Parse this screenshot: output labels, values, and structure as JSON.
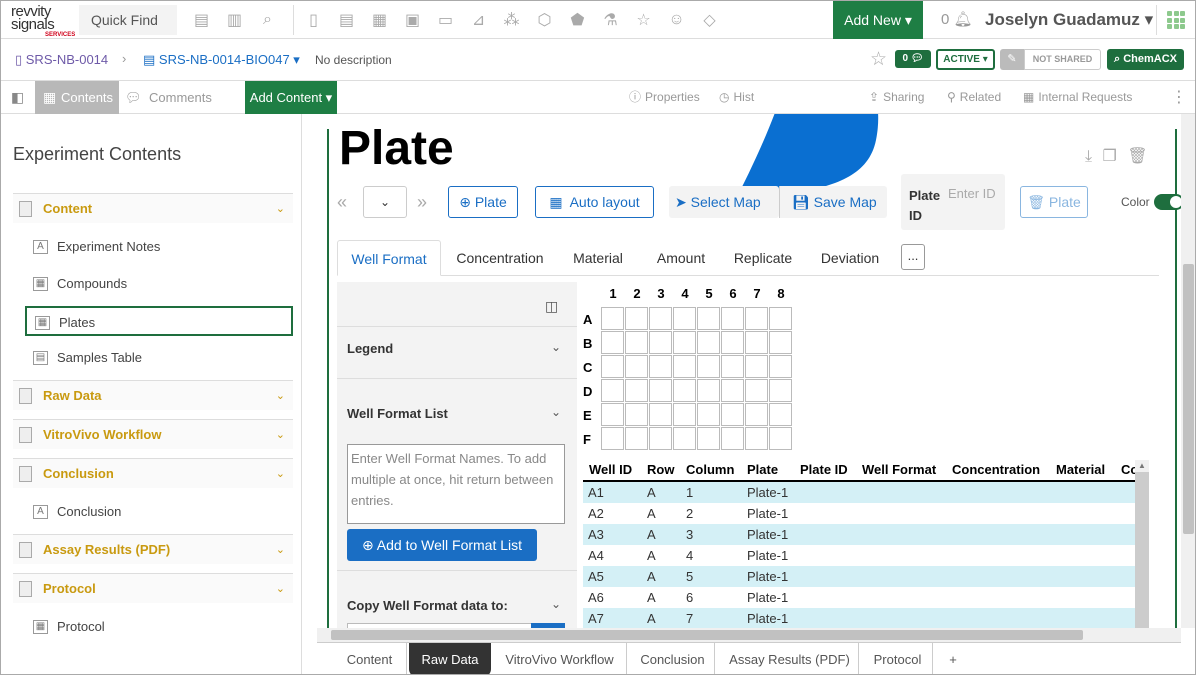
{
  "brand": {
    "line1": "revvity",
    "line2": "signals",
    "line3": "SERVICES"
  },
  "top": {
    "quick_find": "Quick Find",
    "add_new": "Add New ▾",
    "notif_count": "0",
    "user_name": "Joselyn Guadamuz ▾"
  },
  "breadcrumb": {
    "notebook": "SRS-NB-0014",
    "experiment": "SRS-NB-0014-BIO047 ▾",
    "description": "No description",
    "comment_count": "0",
    "status": "ACTIVE ▾",
    "sharing": "NOT SHARED",
    "chem": "ChemACX"
  },
  "toolbar": {
    "contents": "Contents",
    "comments": "Comments",
    "add_content": "Add Content ▾",
    "properties": "Properties",
    "history": "Hist",
    "sharing": "Sharing",
    "related": "Related",
    "internal_requests": "Internal Requests"
  },
  "sidebar": {
    "title": "Experiment Contents",
    "rows": [
      {
        "kind": "cat",
        "label": "Content"
      },
      {
        "kind": "item",
        "label": "Experiment Notes",
        "icon": "A"
      },
      {
        "kind": "item",
        "label": "Compounds",
        "icon": "▦"
      },
      {
        "kind": "item",
        "label": "Plates",
        "icon": "▦",
        "selected": true
      },
      {
        "kind": "item",
        "label": "Samples Table",
        "icon": "▤"
      },
      {
        "kind": "cat",
        "label": "Raw Data"
      },
      {
        "kind": "cat",
        "label": "VitroVivo Workflow"
      },
      {
        "kind": "cat",
        "label": "Conclusion"
      },
      {
        "kind": "item",
        "label": "Conclusion",
        "icon": "A"
      },
      {
        "kind": "cat",
        "label": "Assay Results (PDF)"
      },
      {
        "kind": "cat",
        "label": "Protocol"
      },
      {
        "kind": "item",
        "label": "Protocol",
        "icon": "▦"
      }
    ]
  },
  "plate": {
    "title": "Plate",
    "add_plate": "Plate",
    "auto_layout": "Auto layout",
    "select_map": "Select Map",
    "save_map": "Save Map",
    "plate_id_label": "Plate ID",
    "plate_id_placeholder": "Enter ID",
    "delete_plate": "Plate",
    "color_label": "Color"
  },
  "tabs": [
    "Well Format",
    "Concentration",
    "Material",
    "Amount",
    "Replicate",
    "Deviation"
  ],
  "tab_more": "...",
  "config": {
    "legend": "Legend",
    "well_format_list": "Well Format List",
    "textarea_placeholder": "Enter Well Format Names. To add multiple at once, hit return between entries.",
    "add_button": "Add to Well Format List",
    "copy_label": "Copy Well Format data to:"
  },
  "plate_grid": {
    "columns": [
      "1",
      "2",
      "3",
      "4",
      "5",
      "6",
      "7",
      "8"
    ],
    "rows": [
      "A",
      "B",
      "C",
      "D",
      "E",
      "F"
    ]
  },
  "table": {
    "headers": [
      "Well ID",
      "Row",
      "Column",
      "Plate",
      "Plate ID",
      "Well Format",
      "Concentration",
      "Material",
      "Co"
    ],
    "rows": [
      [
        "A1",
        "A",
        "1",
        "Plate-1"
      ],
      [
        "A2",
        "A",
        "2",
        "Plate-1"
      ],
      [
        "A3",
        "A",
        "3",
        "Plate-1"
      ],
      [
        "A4",
        "A",
        "4",
        "Plate-1"
      ],
      [
        "A5",
        "A",
        "5",
        "Plate-1"
      ],
      [
        "A6",
        "A",
        "6",
        "Plate-1"
      ],
      [
        "A7",
        "A",
        "7",
        "Plate-1"
      ]
    ]
  },
  "bottom_tabs": [
    "Content",
    "Raw Data",
    "VitroVivo Workflow",
    "Conclusion",
    "Assay Results (PDF)",
    "Protocol",
    "+"
  ],
  "colors": {
    "brand_green": "#1e7e44",
    "link_blue": "#1a6ec4",
    "category_gold": "#c99a10",
    "row_highlight": "#d4f0f6",
    "cursor_blue": "#0a6fd1"
  }
}
